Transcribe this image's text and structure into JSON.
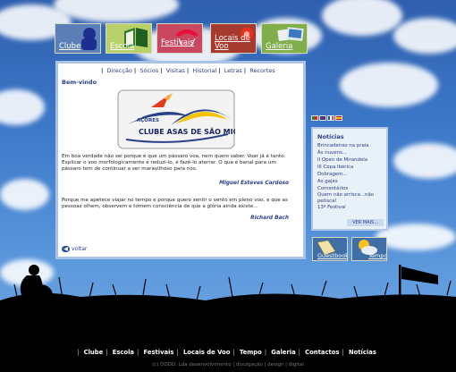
{
  "top_nav": [
    {
      "label": "Clube",
      "icon": "pilot-helmet-icon",
      "bg": "#5c7fb8"
    },
    {
      "label": "Escola",
      "icon": "book-icon",
      "bg": "#b8d06a"
    },
    {
      "label": "Festivais",
      "icon": "kite-icon",
      "bg": "#c9485f"
    },
    {
      "label": "Locais de Voo",
      "icon": "map-pin-icon",
      "bg": "#a63a2e"
    },
    {
      "label": "Galeria",
      "icon": "photos-icon",
      "bg": "#7fae4a"
    }
  ],
  "sub_nav": [
    "Direcção",
    "Sócios",
    "Visitas",
    "Historial",
    "Letras",
    "Recortes"
  ],
  "main": {
    "heading": "Bem-vindo",
    "logo_text_top": "AÇORES",
    "logo_text": "CLUBE ASAS DE SÃO MIGUEL",
    "quote1": "Em boa verdade não sei porque é que um pássaro voa, nem quero saber. Voar já é tanto. Explicar o voo morfologicamente é reduzi-lo, é fazê-lo aterrar. O que é banal para um pássaro tem de continuar a ser maravilhoso para nós.",
    "author1": "Miguel Esteves Cardoso",
    "quote2": "Porque me apetece viajar no tempo e porque quero sentir o vento em pleno voo, e que as pessoas olhem, observem e tomem consciência de que a glória ainda existe...",
    "author2": "Richard Bach",
    "back_label": "voltar"
  },
  "flags": [
    {
      "name": "portugal-flag-icon",
      "colors": [
        "#1a8a3a",
        "#d52b1e"
      ]
    },
    {
      "name": "uk-flag-icon",
      "colors": [
        "#2a3f8a",
        "#c8102e"
      ]
    },
    {
      "name": "france-flag-icon",
      "colors": [
        "#0055a4",
        "#ef4135"
      ]
    },
    {
      "name": "spain-flag-icon",
      "colors": [
        "#c60b1e",
        "#ffc400"
      ]
    }
  ],
  "news": {
    "title": "Notícias",
    "items": [
      "Brincadeiras na praia",
      "Às nuvens...",
      "II Open de Mirandela",
      "III Copa Ibérica",
      "Dobragem...",
      "As gajas",
      "Comentários",
      "Quem não arrisca...não petisca!",
      "13º Festival"
    ],
    "more": "VER MAIS..."
  },
  "bottom_tiles": [
    {
      "label": "Guestbook",
      "icon": "notebook-icon"
    },
    {
      "label": "Tempo",
      "icon": "weather-sun-cloud-icon"
    }
  ],
  "footer_nav": [
    "Clube",
    "Escola",
    "Festivais",
    "Locais de Voo",
    "Tempo",
    "Galeria",
    "Contactos",
    "Notícias"
  ],
  "copyright": "(c) DDDD, Lda desenvolvimento | divulgação | design | digital"
}
